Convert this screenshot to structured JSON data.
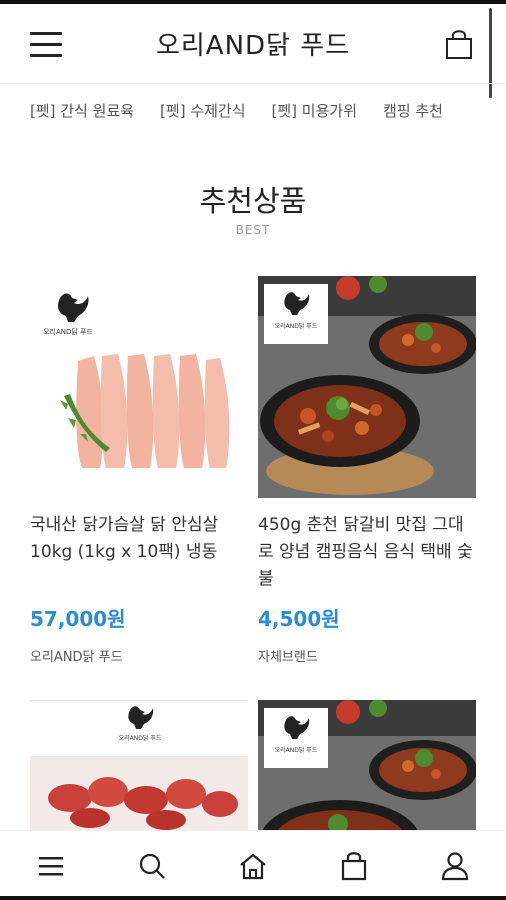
{
  "header": {
    "title": "오리AND닭 푸드"
  },
  "categories": [
    "[펫] 간식 원료육",
    "[펫] 수제간식",
    "[펫] 미용가위",
    "캠핑 추천"
  ],
  "section": {
    "title": "추천상품",
    "subtitle": "BEST"
  },
  "products": [
    {
      "name": "국내산 닭가슴살 닭 안심살 10kg (1kg x 10팩) 냉동",
      "price": "57,000원",
      "brand": "오리AND닭 푸드",
      "logo_text": "오리AND닭 푸드"
    },
    {
      "name": "450g 춘천 닭갈비 맛집 그대로 양념 캠핑음식 음식 택배 숯불",
      "price": "4,500원",
      "brand": "자체브랜드",
      "logo_text": "오리AND닭 푸드"
    },
    {
      "logo_text": "오리AND닭 푸드"
    },
    {
      "logo_text": "오리AND닭 푸드"
    }
  ],
  "bottom_nav": [
    "menu-icon",
    "search-icon",
    "home-icon",
    "shopping-bag-icon",
    "user-icon"
  ],
  "colors": {
    "price": "#2a8bd7",
    "pan": "#1f1f1f",
    "chicken": "#f2b7a4",
    "background_dark": "#6b6b6b"
  }
}
